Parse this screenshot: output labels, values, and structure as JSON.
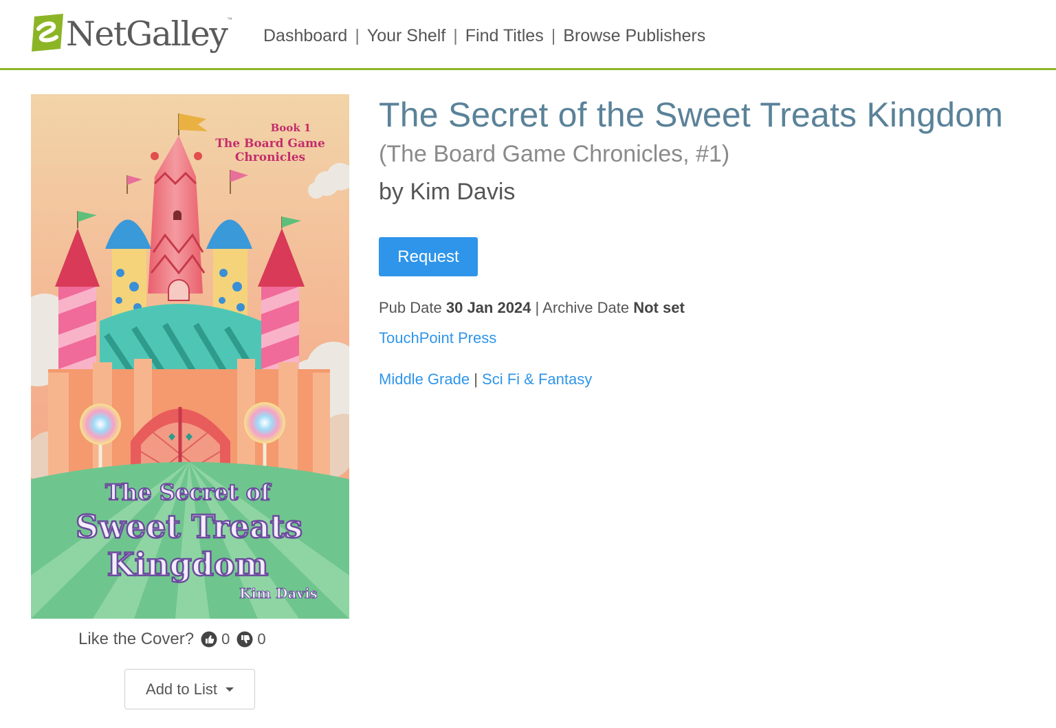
{
  "header": {
    "logo_text": "NetGalley",
    "logo_tm": "™",
    "nav": [
      {
        "label": "Dashboard"
      },
      {
        "label": "Your Shelf"
      },
      {
        "label": "Find Titles"
      },
      {
        "label": "Browse Publishers"
      }
    ],
    "nav_separator": "|",
    "accent_color": "#8cb526"
  },
  "book": {
    "title": "The Secret of the Sweet Treats Kingdom",
    "series": "(The Board Game Chronicles, #1)",
    "author": "by Kim Davis",
    "request_label": "Request",
    "pub_date_label": "Pub Date",
    "pub_date": "30 Jan 2024",
    "date_separator": "|",
    "archive_date_label": "Archive Date",
    "archive_date": "Not set",
    "publisher": "TouchPoint Press",
    "categories": [
      "Middle Grade",
      "Sci Fi & Fantasy"
    ],
    "category_separator": "|",
    "link_color": "#2e95ea",
    "title_color": "#5a8299"
  },
  "cover": {
    "book_number": "Book 1",
    "series_line1": "The Board Game",
    "series_line2": "Chronicles",
    "title_line1": "The Secret of",
    "title_line2": "Sweet Treats",
    "title_line3": "Kingdom",
    "author": "Kim Davis"
  },
  "cover_votes": {
    "label": "Like the Cover?",
    "thumbs_up_icon": "thumbs-up-icon",
    "thumbs_down_icon": "thumbs-down-icon",
    "likes": "0",
    "dislikes": "0"
  },
  "add_to_list": {
    "label": "Add to List",
    "icon": "caret-down-icon"
  }
}
